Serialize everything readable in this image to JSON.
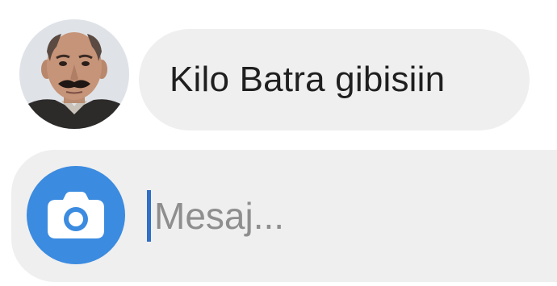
{
  "conversation": {
    "incoming_message": {
      "avatar_icon": "contact-avatar-photo",
      "text": "Kilo Batra gibisiin"
    }
  },
  "composer": {
    "camera_icon": "camera-icon",
    "camera_button_color": "#3b8be0",
    "input_value": "",
    "input_placeholder": "Mesaj..."
  }
}
